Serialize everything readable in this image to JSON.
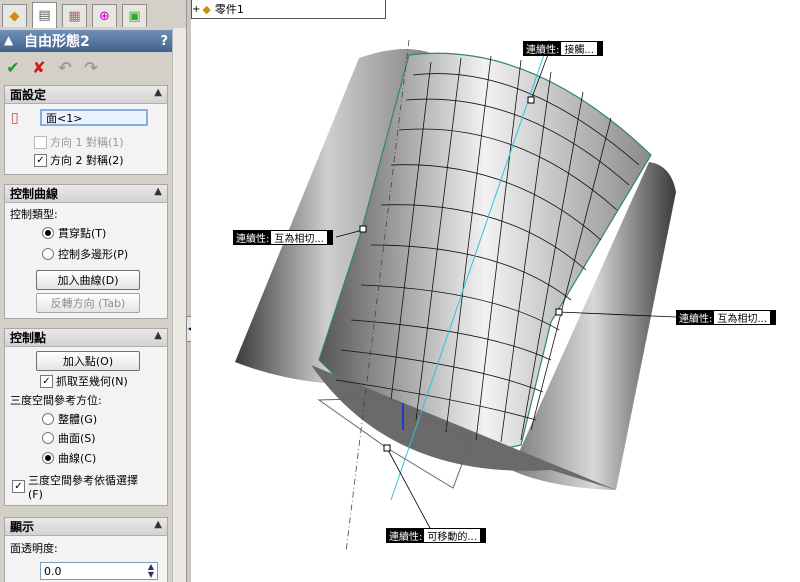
{
  "tree": {
    "node_label": "零件1",
    "expand_symbol": "+"
  },
  "feature": {
    "title": "自由形態2",
    "help": "?"
  },
  "sections": {
    "face": {
      "title": "面設定",
      "face_value": "面<1>",
      "dir1_label": "方向 1 對稱(1)",
      "dir1_checked": false,
      "dir1_enabled": false,
      "dir2_label": "方向 2 對稱(2)",
      "dir2_checked": true
    },
    "curves": {
      "title": "控制曲線",
      "type_label": "控制類型:",
      "opt_through": "貫穿點(T)",
      "opt_polygon": "控制多邊形(P)",
      "selected": "貫穿點(T)",
      "add_curve": "加入曲線(D)",
      "flip_dir": "反轉方向 (Tab)"
    },
    "points": {
      "title": "控制點",
      "add_point": "加入點(O)",
      "snap_label": "抓取至幾何(N)",
      "snap_checked": true,
      "triad_label": "三度空間參考方位:",
      "opt_global": "整體(G)",
      "opt_surface": "曲面(S)",
      "opt_curve": "曲線(C)",
      "selected": "曲線(C)",
      "follow_label": "三度空間參考依循選擇",
      "follow_hotkey": "(F)",
      "follow_checked": true
    },
    "display": {
      "title": "顯示",
      "transparency_label": "面透明度:",
      "transparency_value": "0.0"
    }
  },
  "callouts": {
    "top": {
      "key": "連續性:",
      "value": "接觸..."
    },
    "left": {
      "key": "連續性:",
      "value": "互為相切..."
    },
    "right": {
      "key": "連續性:",
      "value": "互為相切..."
    },
    "bottom": {
      "key": "連續性:",
      "value": "可移動的..."
    }
  },
  "colors": {
    "title_bar": "#4e6f9a",
    "surface_edge": "#2e8b57",
    "ok_green": "#1a9e1a",
    "cancel_red": "#d01818",
    "centerline": "#33bfe0"
  }
}
